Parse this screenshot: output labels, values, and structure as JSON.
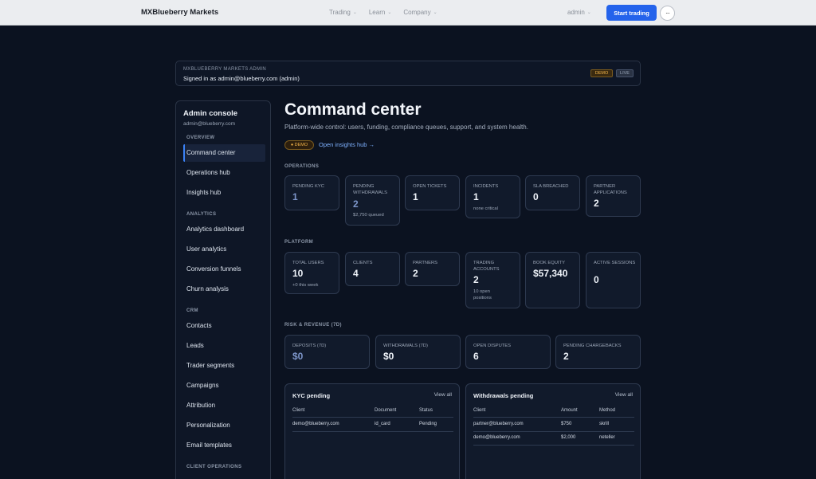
{
  "nav": {
    "brand": "MXBlueberry Markets",
    "links": [
      "Trading",
      "Learn",
      "Company"
    ],
    "user": "admin",
    "cta": "Start trading",
    "more": "···"
  },
  "banner": {
    "eyebrow": "MXBLUEBERRY MARKETS ADMIN",
    "signed_in": "Signed in as admin@blueberry.com (admin)",
    "tag_demo": "DEMO",
    "tag_live": "LIVE"
  },
  "sidebar": {
    "title": "Admin console",
    "email": "admin@blueberry.com",
    "sections": [
      {
        "label": "OVERVIEW",
        "items": [
          "Command center",
          "Operations hub",
          "Insights hub"
        ]
      },
      {
        "label": "ANALYTICS",
        "items": [
          "Analytics dashboard",
          "User analytics",
          "Conversion funnels",
          "Churn analysis"
        ]
      },
      {
        "label": "CRM",
        "items": [
          "Contacts",
          "Leads",
          "Trader segments",
          "Campaigns",
          "Attribution",
          "Personalization",
          "Email templates"
        ]
      },
      {
        "label": "CLIENT OPERATIONS",
        "items": []
      }
    ]
  },
  "main": {
    "title": "Command center",
    "subtitle": "Platform-wide control: users, funding, compliance queues, support, and system health.",
    "demo_pill": "● DEMO",
    "insights_link": "Open insights hub →",
    "operations": {
      "label": "OPERATIONS",
      "cards": [
        {
          "label": "PENDING KYC",
          "value": "1",
          "note": ""
        },
        {
          "label": "PENDING WITHDRAWALS",
          "value": "2",
          "note": "$2,750 queued"
        },
        {
          "label": "OPEN TICKETS",
          "value": "1",
          "note": ""
        },
        {
          "label": "INCIDENTS",
          "value": "1",
          "note": "none critical"
        },
        {
          "label": "SLA BREACHED",
          "value": "0",
          "note": ""
        },
        {
          "label": "PARTNER APPLICATIONS",
          "value": "2",
          "note": ""
        }
      ]
    },
    "platform": {
      "label": "PLATFORM",
      "cards": [
        {
          "label": "TOTAL USERS",
          "value": "10",
          "note": "+0 this week"
        },
        {
          "label": "CLIENTS",
          "value": "4",
          "note": ""
        },
        {
          "label": "PARTNERS",
          "value": "2",
          "note": ""
        },
        {
          "label": "TRADING ACCOUNTS",
          "value": "2",
          "note": "10 open positions"
        },
        {
          "label": "BOOK EQUITY",
          "value": "$57,340",
          "note": ""
        },
        {
          "label": "ACTIVE SESSIONS",
          "value": "0",
          "note": ""
        }
      ]
    },
    "risk": {
      "label": "RISK & REVENUE (7D)",
      "cards": [
        {
          "label": "DEPOSITS (7D)",
          "value": "$0"
        },
        {
          "label": "WITHDRAWALS (7D)",
          "value": "$0"
        },
        {
          "label": "OPEN DISPUTES",
          "value": "6"
        },
        {
          "label": "PENDING CHARGEBACKS",
          "value": "2"
        }
      ]
    },
    "kyc": {
      "title": "KYC pending",
      "view_all": "View all",
      "columns": [
        "Client",
        "Document",
        "Status"
      ],
      "rows": [
        [
          "demo@blueberry.com",
          "id_card",
          "Pending"
        ]
      ]
    },
    "withdrawals": {
      "title": "Withdrawals pending",
      "view_all": "View all",
      "columns": [
        "Client",
        "Amount",
        "Method"
      ],
      "rows": [
        [
          "partner@blueberry.com",
          "$750",
          "skrill"
        ],
        [
          "demo@blueberry.com",
          "$2,000",
          "neteller"
        ]
      ]
    }
  }
}
